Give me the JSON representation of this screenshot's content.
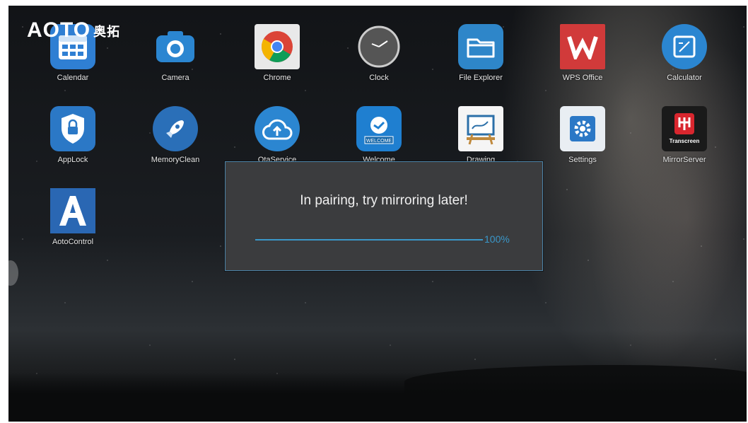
{
  "logo": {
    "brand": "AOTO",
    "brand_cn": "奥拓"
  },
  "apps": [
    {
      "label": "Calendar",
      "icon": "calendar-icon"
    },
    {
      "label": "Camera",
      "icon": "camera-icon"
    },
    {
      "label": "Chrome",
      "icon": "chrome-icon"
    },
    {
      "label": "Clock",
      "icon": "clock-icon"
    },
    {
      "label": "File Explorer",
      "icon": "folder-icon"
    },
    {
      "label": "WPS Office",
      "icon": "wps-icon"
    },
    {
      "label": "Calculator",
      "icon": "calculator-icon"
    },
    {
      "label": "AppLock",
      "icon": "lock-icon"
    },
    {
      "label": "MemoryClean",
      "icon": "rocket-icon"
    },
    {
      "label": "OtaService",
      "icon": "cloud-upload-icon"
    },
    {
      "label": "Welcome",
      "icon": "welcome-icon",
      "badge": "WELCOME"
    },
    {
      "label": "Drawing",
      "icon": "easel-icon"
    },
    {
      "label": "Settings",
      "icon": "gear-icon"
    },
    {
      "label": "MirrorServer",
      "icon": "mirror-icon",
      "badge": "Transcreen"
    },
    {
      "label": "AotoControl",
      "icon": "aoto-a-icon"
    }
  ],
  "dialog": {
    "message": "In pairing, try mirroring later!",
    "progress": 1.0,
    "progress_text": "100%"
  },
  "colors": {
    "accent": "#3a97c9",
    "dialog_bg": "#3b3c3e",
    "dialog_border": "#4d84a8"
  }
}
